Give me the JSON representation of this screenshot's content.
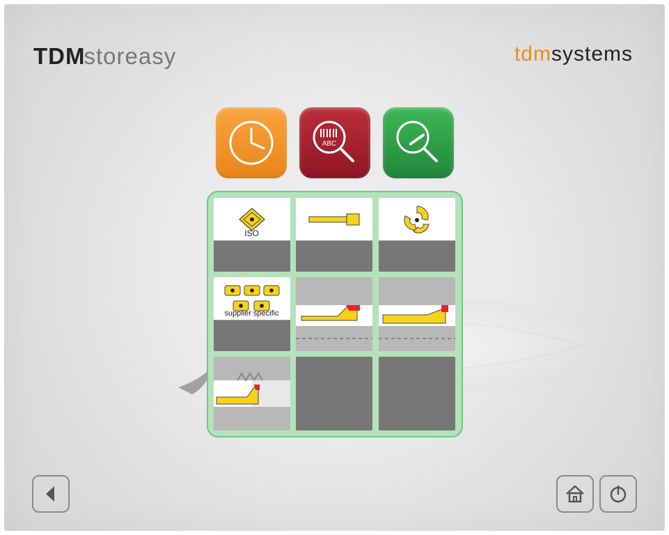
{
  "header": {
    "left_logo_bold": "TDM",
    "left_logo_light": "storeasy",
    "right_logo_tdm": "tdm",
    "right_logo_sys": "systems"
  },
  "top_buttons": [
    {
      "name": "recent-button",
      "icon": "clock-icon",
      "color": "orange"
    },
    {
      "name": "barcode-search",
      "icon": "barcode-magnifier-icon",
      "color": "red"
    },
    {
      "name": "tool-search",
      "icon": "tool-magnifier-icon",
      "color": "green"
    }
  ],
  "categories": [
    {
      "name": "category-iso",
      "label": "ISO",
      "icon": "insert-rhombus"
    },
    {
      "name": "category-bar-tool",
      "label": "",
      "icon": "bar-tool"
    },
    {
      "name": "category-threading-insert",
      "label": "",
      "icon": "threading-insert"
    },
    {
      "name": "category-supplier",
      "label": "supplier specific",
      "icon": "multi-inserts"
    },
    {
      "name": "category-turning-1",
      "label": "",
      "icon": "turning-tool-a"
    },
    {
      "name": "category-turning-2",
      "label": "",
      "icon": "turning-tool-b"
    },
    {
      "name": "category-grooving",
      "label": "",
      "icon": "grooving-tool"
    },
    {
      "name": "category-empty-1",
      "label": "",
      "icon": ""
    },
    {
      "name": "category-empty-2",
      "label": "",
      "icon": ""
    }
  ],
  "footer": {
    "back": "back-button",
    "home": "home-button",
    "power": "power-button"
  }
}
